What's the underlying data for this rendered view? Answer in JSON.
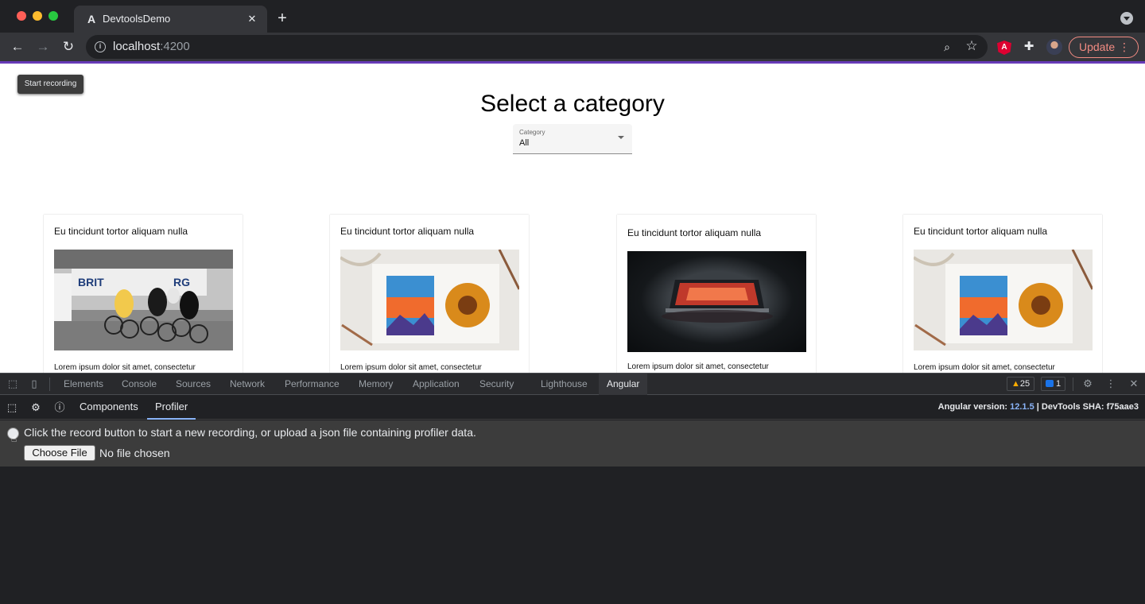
{
  "browser": {
    "tab_title": "DevtoolsDemo",
    "url_host": "localhost",
    "url_port": ":4200",
    "update_label": "Update",
    "colors": {
      "accent_bar": "#673ab7",
      "update": "#f28b82"
    }
  },
  "page": {
    "title": "Select a category",
    "select": {
      "label": "Category",
      "value": "All"
    },
    "cards": [
      {
        "title": "Eu tincidunt tortor aliquam nulla",
        "image": "cycling-race-photo",
        "text": "Lorem ipsum dolor sit amet, consectetur"
      },
      {
        "title": "Eu tincidunt tortor aliquam nulla",
        "image": "watercolor-painting-photo",
        "text": "Lorem ipsum dolor sit amet, consectetur"
      },
      {
        "title": "Eu tincidunt tortor aliquam nulla",
        "image": "glowing-laptop-photo",
        "text": "Lorem ipsum dolor sit amet, consectetur"
      },
      {
        "title": "Eu tincidunt tortor aliquam nulla",
        "image": "watercolor-painting-photo",
        "text": "Lorem ipsum dolor sit amet, consectetur"
      }
    ]
  },
  "devtools": {
    "tabs": [
      "Elements",
      "Console",
      "Sources",
      "Network",
      "Performance",
      "Memory",
      "Application",
      "Security",
      "Lighthouse",
      "Angular"
    ],
    "active_tab": "Angular",
    "warnings_count": "25",
    "messages_count": "1",
    "angular": {
      "tabs": [
        "Components",
        "Profiler"
      ],
      "active_tab": "Profiler",
      "version_label": "Angular version:",
      "version": "12.1.5",
      "sha_label": "| DevTools SHA: f75aae3",
      "profiler_message": "Click the record button to start a new recording, or upload a json file containing profiler data.",
      "file_button": "Choose File",
      "file_status": "No file chosen",
      "tooltip": "Start recording"
    }
  }
}
